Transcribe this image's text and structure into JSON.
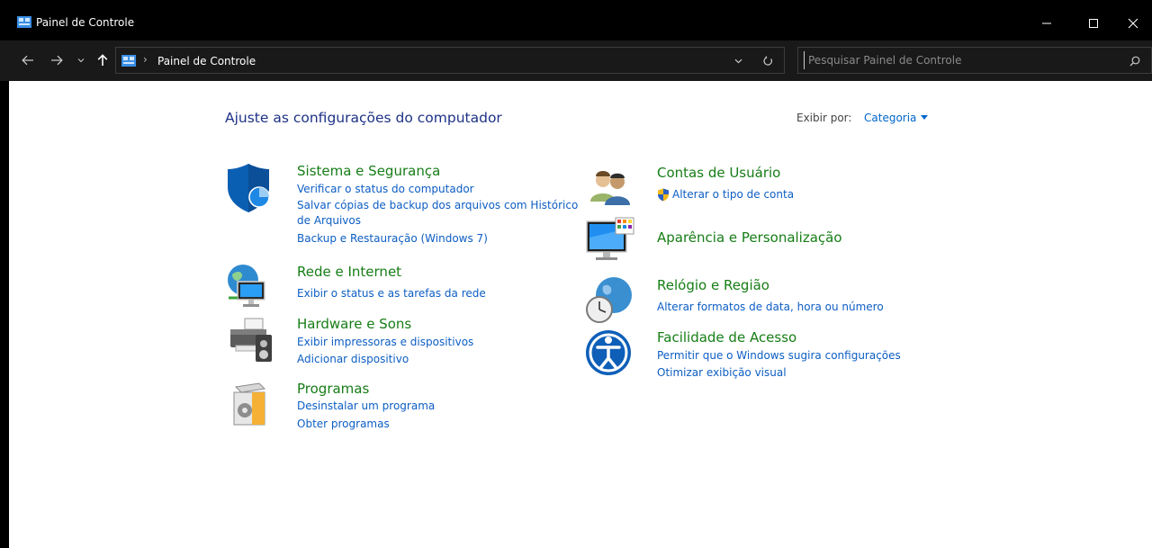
{
  "window": {
    "title": "Painel de Controle"
  },
  "address": {
    "breadcrumb": "Painel de Controle",
    "separator": "›"
  },
  "search": {
    "placeholder": "Pesquisar Painel de Controle"
  },
  "main": {
    "title": "Ajuste as configurações do computador",
    "view_by_label": "Exibir por:",
    "view_by_value": "Categoria"
  },
  "categories": {
    "system": {
      "title": "Sistema e Segurança",
      "links": [
        "Verificar o status do computador",
        "Salvar cópias de backup dos arquivos com Histórico",
        "de Arquivos",
        "Backup e Restauração (Windows 7)"
      ]
    },
    "network": {
      "title": "Rede e Internet",
      "links": [
        "Exibir o status e as tarefas da rede"
      ]
    },
    "hardware": {
      "title": "Hardware e Sons",
      "links": [
        "Exibir impressoras e dispositivos",
        "Adicionar dispositivo"
      ]
    },
    "programs": {
      "title": "Programas",
      "links": [
        "Desinstalar um programa",
        "Obter programas"
      ]
    },
    "accounts": {
      "title": "Contas de Usuário",
      "links": [
        "Alterar o tipo de conta"
      ]
    },
    "appearance": {
      "title": "Aparência e Personalização",
      "links": []
    },
    "clock": {
      "title": "Relógio e Região",
      "links": [
        "Alterar formatos de data, hora ou número"
      ]
    },
    "access": {
      "title": "Facilidade de Acesso",
      "links": [
        "Permitir que o Windows sugira configurações",
        "Otimizar exibição visual"
      ]
    }
  },
  "colors": {
    "heading_green": "#167d16",
    "link_blue": "#0d5ec4",
    "title_blue": "#1e3287",
    "titlebar_bg": "#000000",
    "navbar_bg": "#191919"
  },
  "icons": [
    "control-panel-icon",
    "minimize-icon",
    "maximize-icon",
    "close-icon",
    "back-arrow-icon",
    "forward-arrow-icon",
    "recent-chevron-icon",
    "up-arrow-icon",
    "dropdown-chevron-icon",
    "refresh-icon",
    "search-icon",
    "shield-icon",
    "network-globe-icon",
    "printer-icon",
    "programs-box-icon",
    "users-icon",
    "uac-shield-icon",
    "monitor-palette-icon",
    "clock-globe-icon",
    "accessibility-icon"
  ]
}
